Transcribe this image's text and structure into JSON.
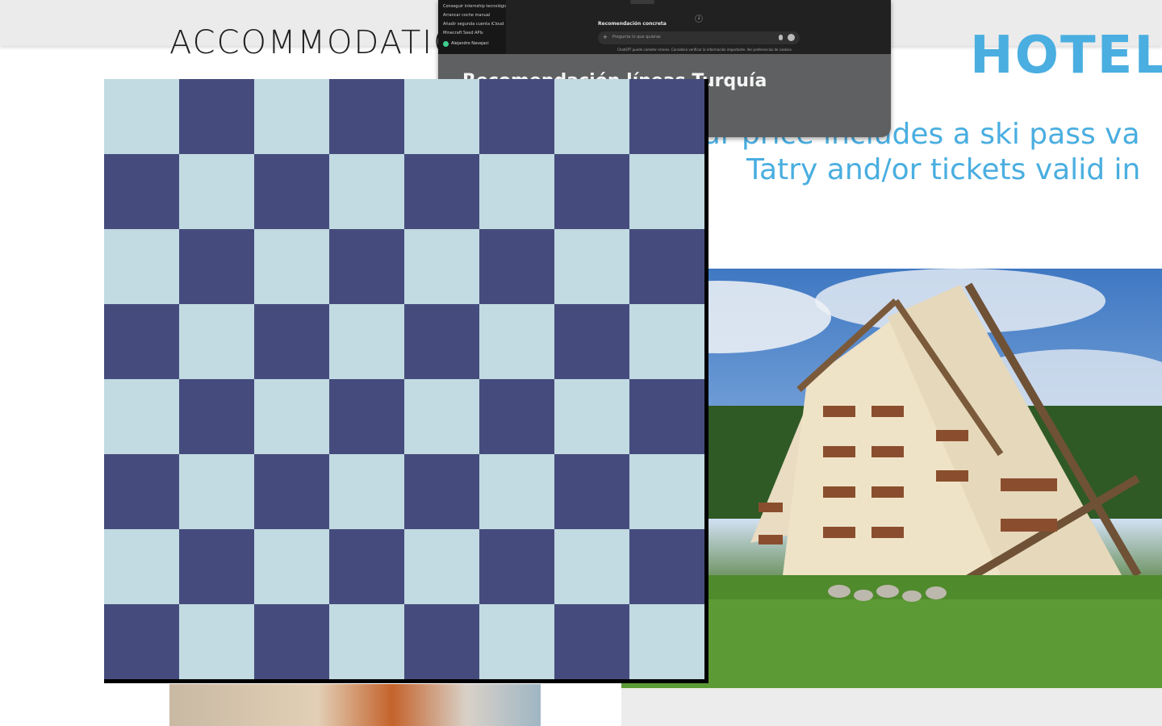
{
  "page": {
    "left_heading": "ACCOMMODATIC",
    "right_heading": "HOTEL",
    "subtitle_line1": "ur price includes a ski pass va",
    "subtitle_line2": "Tatry and/or tickets valid in"
  },
  "overlay_window": {
    "sidebar_items": [
      "Conseguir internship tecnológica...",
      "Arrancar coche manual",
      "Añadir segunda cuenta iCloud",
      "Minecraft Seed APIs"
    ],
    "user_name": "Alejandro Navajaci",
    "section_label": "Recomendación concreta",
    "input_placeholder": "Pregunta lo que quieras",
    "disclaimer": "ChatGPT puede cometer errores. Considera verificar la información importante. Ver preferencias de cookies.",
    "window_title": "Recomendación líneas Turquía"
  },
  "board": {
    "rows": 8,
    "cols": 8,
    "light_color": "#c2dae1",
    "dark_color": "#454c7d"
  },
  "colors": {
    "accent": "#4aaee0"
  }
}
